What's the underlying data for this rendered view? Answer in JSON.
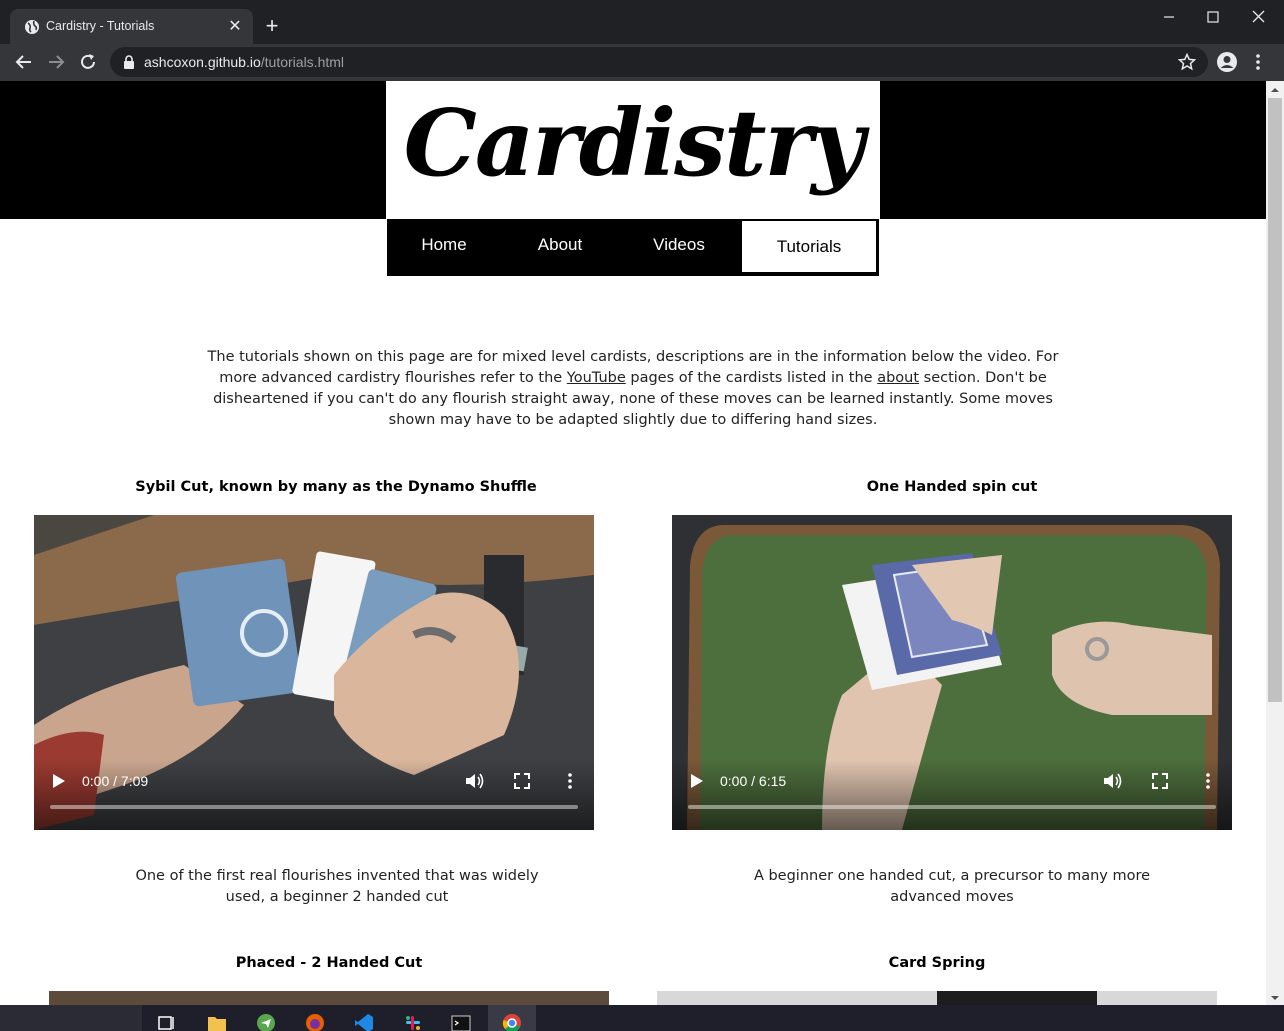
{
  "browser": {
    "tab_title": "Cardistry - Tutorials",
    "tab_close": "✕",
    "new_tab": "+",
    "url_host": "ashcoxon.github.io",
    "url_path": "/tutorials.html"
  },
  "site": {
    "logo": "Cardistry",
    "nav": [
      {
        "label": "Home"
      },
      {
        "label": "About"
      },
      {
        "label": "Videos"
      },
      {
        "label": "Tutorials",
        "active": true
      }
    ],
    "intro": {
      "part1": "The tutorials shown on this page are for mixed level cardists, descriptions are in the information below the video. For more advanced cardistry flourishes refer to the ",
      "link_youtube": "YouTube",
      "part2": " pages of the cardists listed in the ",
      "link_about": "about",
      "part3": " section. Don't be disheartened if you can't do any flourish straight away, none of these moves can be learned instantly. Some moves shown may have to be adapted slightly due to differing hand sizes."
    },
    "videos": [
      {
        "title": "Sybil Cut, known by many as the Dynamo Shuffle",
        "time": "0:00 / 7:09",
        "description": "One of the first real flourishes invented that was widely used, a beginner 2 handed cut"
      },
      {
        "title": "One Handed spin cut",
        "time": "0:00 / 6:15",
        "description": "A beginner one handed cut, a precursor to many more advanced moves"
      },
      {
        "title": "Phaced - 2 Handed Cut"
      },
      {
        "title": "Card Spring"
      }
    ]
  },
  "colors": {
    "chrome_dark": "#202124",
    "chrome_toolbar": "#35363a",
    "banner": "#000000",
    "felt_green": "#4d6e3d",
    "card_blue": "#6f93b9"
  }
}
